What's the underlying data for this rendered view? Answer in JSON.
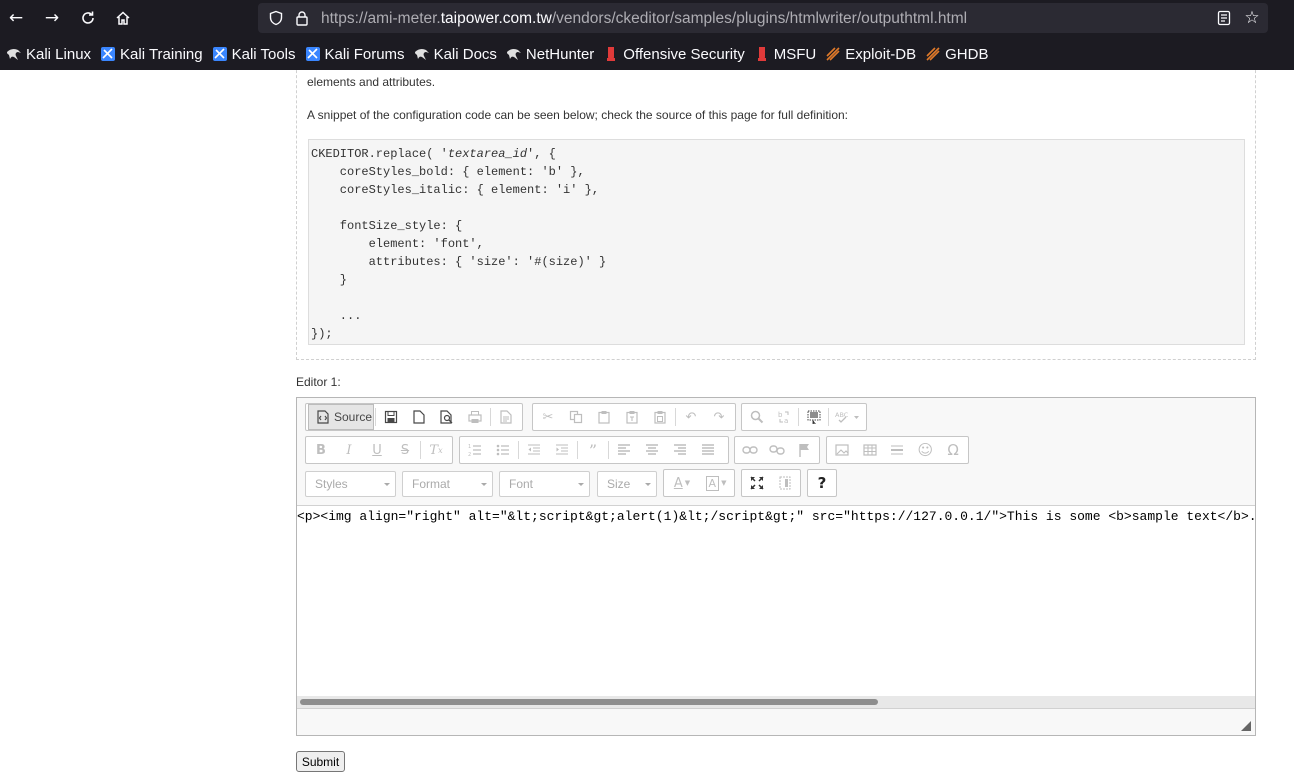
{
  "browser": {
    "url_prefix": "https://ami-meter.",
    "url_domain": "taipower.com.tw",
    "url_path": "/vendors/ckeditor/samples/plugins/htmlwriter/outputhtml.html",
    "bookmarks": [
      {
        "label": "Kali Linux",
        "icon": "kali-dragon-icon"
      },
      {
        "label": "Kali Training",
        "icon": "kali-training-icon"
      },
      {
        "label": "Kali Tools",
        "icon": "kali-tools-icon"
      },
      {
        "label": "Kali Forums",
        "icon": "kali-forums-icon"
      },
      {
        "label": "Kali Docs",
        "icon": "kali-dragon-icon"
      },
      {
        "label": "NetHunter",
        "icon": "nethunter-icon"
      },
      {
        "label": "Offensive Security",
        "icon": "offsec-icon"
      },
      {
        "label": "MSFU",
        "icon": "offsec-icon"
      },
      {
        "label": "Exploit-DB",
        "icon": "exploitdb-icon"
      },
      {
        "label": "GHDB",
        "icon": "exploitdb-icon"
      }
    ]
  },
  "page": {
    "text_top": "elements and attributes.",
    "text_snippet": "A snippet of the configuration code can be seen below; check the source of this page for full definition:",
    "editor_label": "Editor 1:",
    "submit_label": "Submit"
  },
  "code": {
    "line1_a": "CKEDITOR.replace( '",
    "line1_b": "textarea_id",
    "line1_c": "', {",
    "lines": [
      "    coreStyles_bold: { element: 'b' },",
      "    coreStyles_italic: { element: 'i' },",
      "",
      "    fontSize_style: {",
      "        element: 'font',",
      "        attributes: { 'size': '#(size)' }",
      "    }",
      "",
      "    ...",
      "});"
    ]
  },
  "editor": {
    "source_label": "Source",
    "styles_label": "Styles",
    "format_label": "Format",
    "font_label": "Font",
    "size_label": "Size",
    "help_label": "?",
    "source_content": "<p><img align=\"right\" alt=\"&lt;script&gt;alert(1)&lt;/script&gt;\" src=\"https://127.0.0.1/\">This is some <b>sample text</b>. You are using"
  }
}
